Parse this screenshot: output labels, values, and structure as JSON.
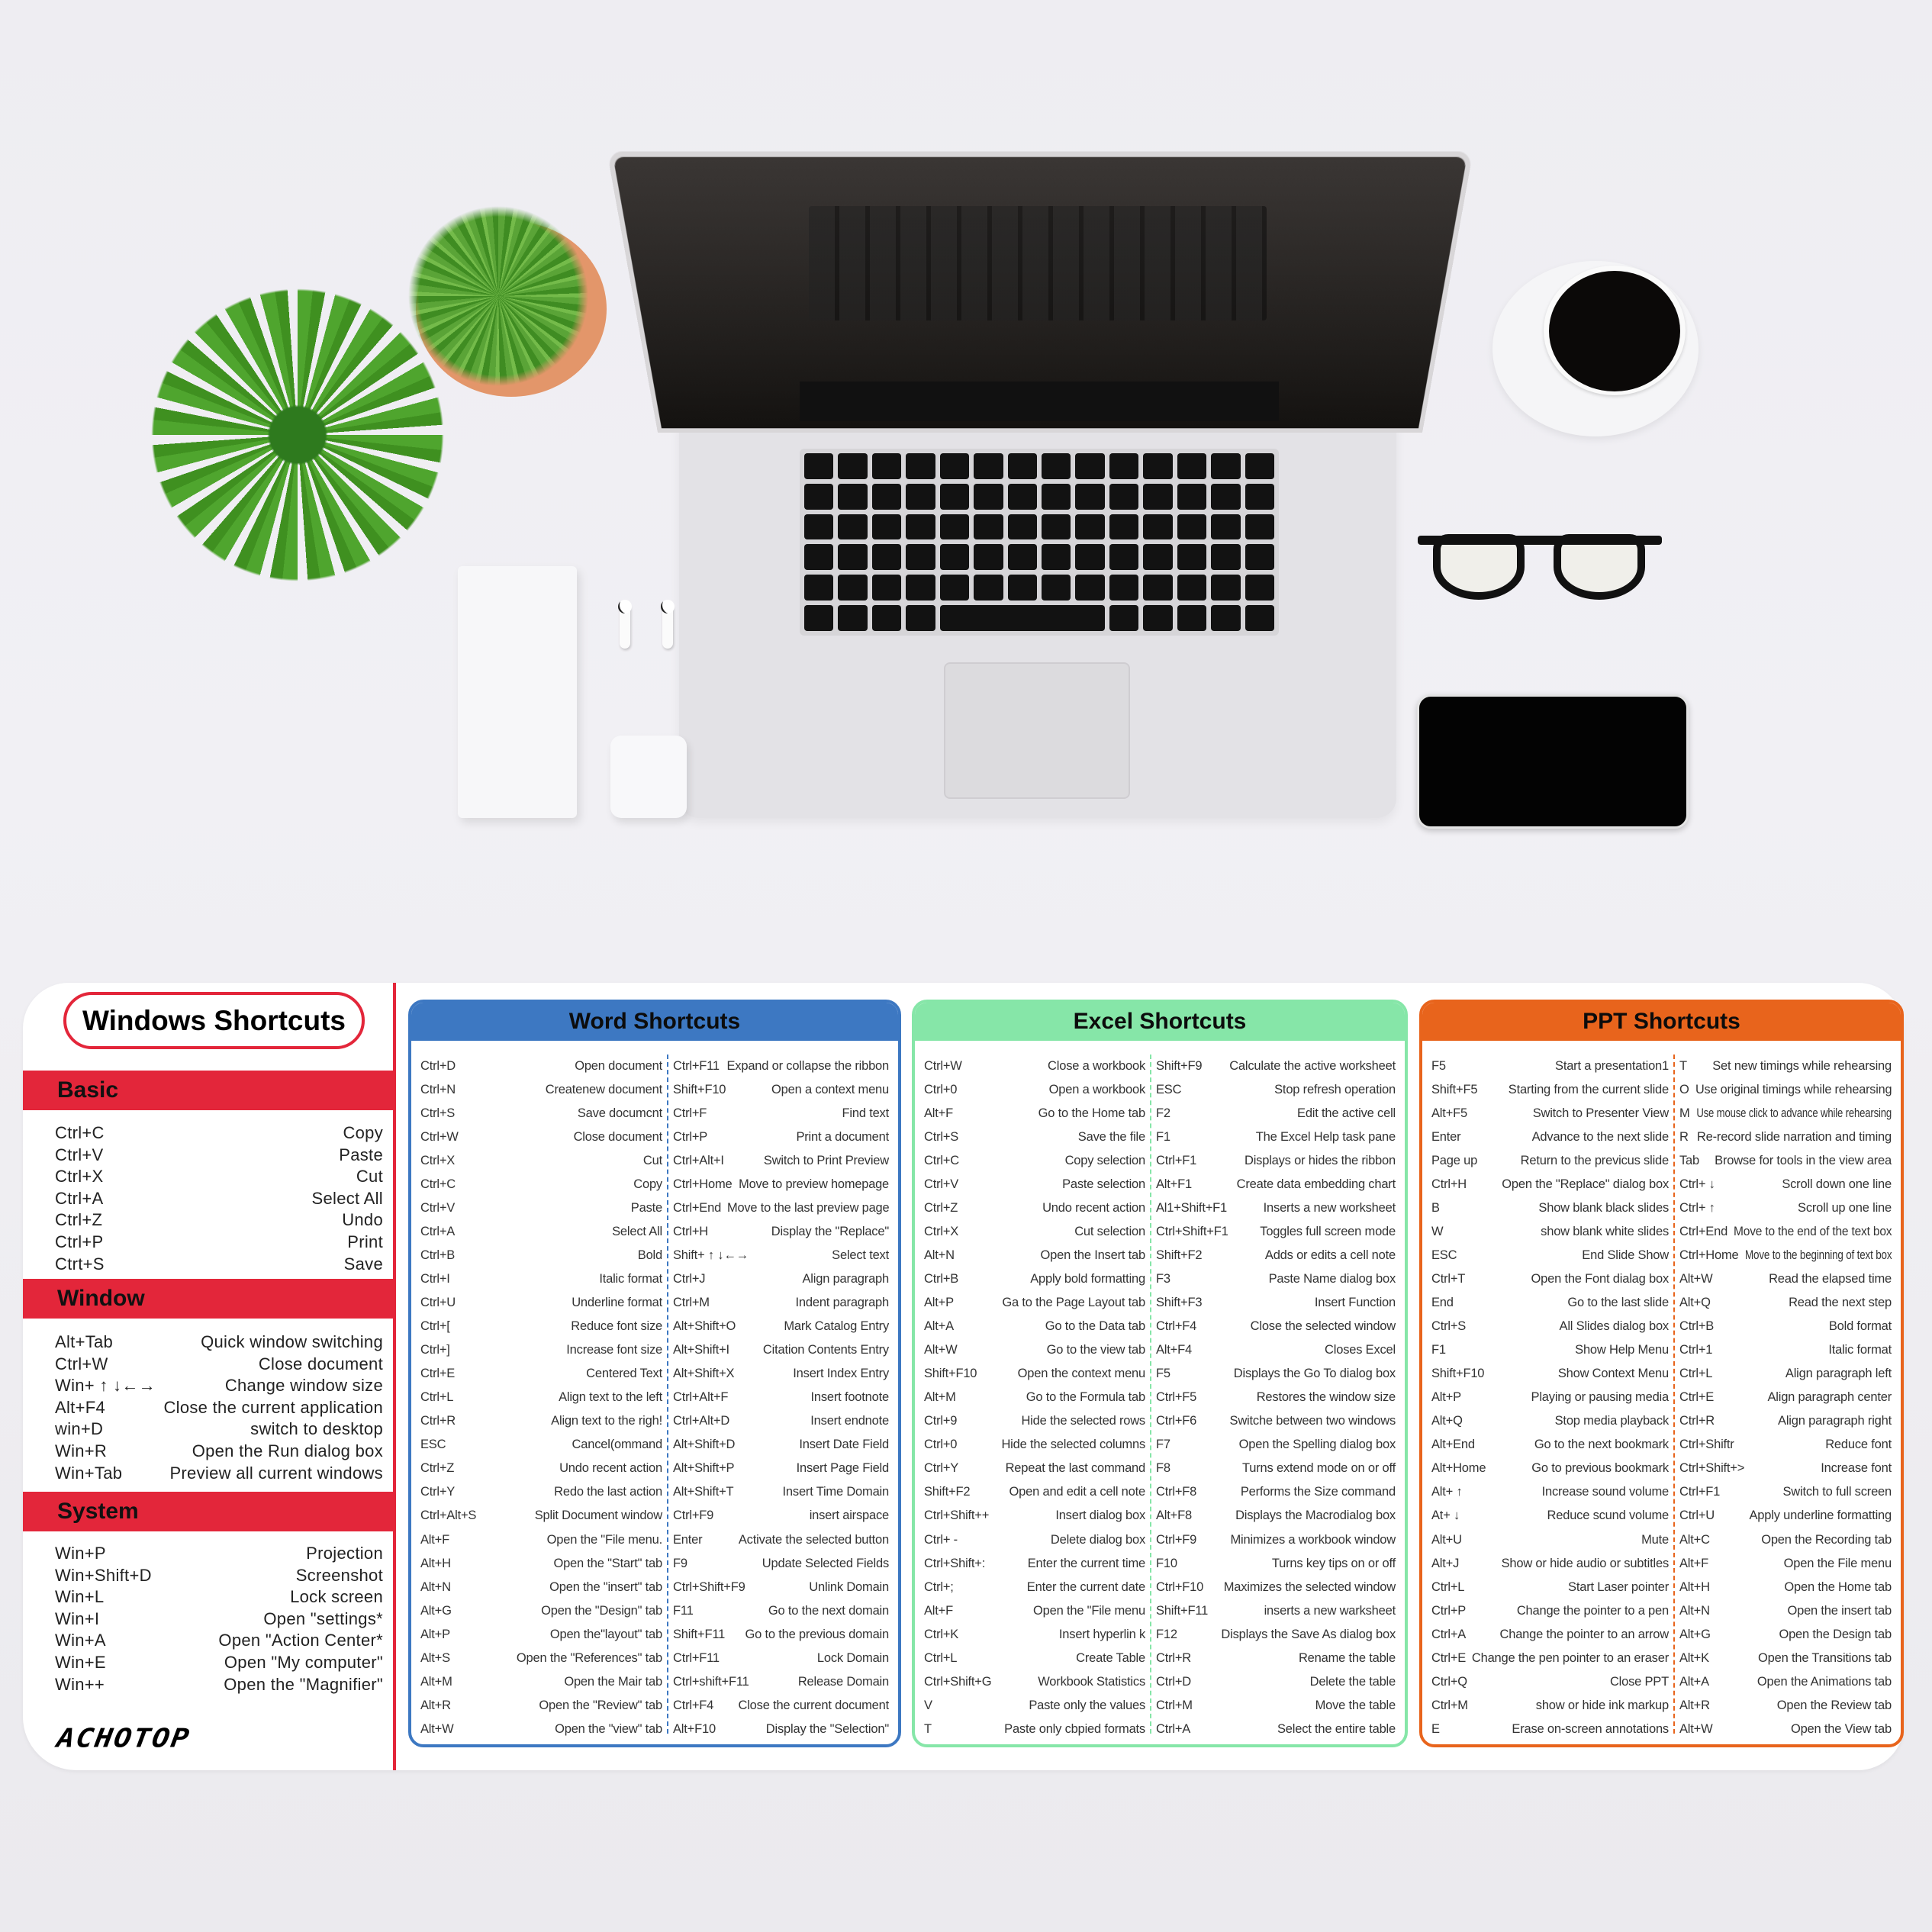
{
  "photo": {
    "objects": [
      "laptop",
      "potted-palm",
      "potted-succulent",
      "notepad",
      "airpods",
      "airpods-case",
      "coffee-cup",
      "glasses",
      "smartphone"
    ]
  },
  "windows": {
    "title": "Windows Shortcuts",
    "brand": "ACHOTOP",
    "sections": [
      {
        "title": "Basic",
        "rows": [
          {
            "key": "Ctrl+C",
            "desc": "Copy"
          },
          {
            "key": "Ctrl+V",
            "desc": "Paste"
          },
          {
            "key": "Ctrl+X",
            "desc": "Cut"
          },
          {
            "key": "Ctrl+A",
            "desc": "Select All"
          },
          {
            "key": "Ctrl+Z",
            "desc": "Undo"
          },
          {
            "key": "Ctrl+P",
            "desc": "Print"
          },
          {
            "key": "Ctrt+S",
            "desc": "Save"
          }
        ]
      },
      {
        "title": "Window",
        "rows": [
          {
            "key": "Alt+Tab",
            "desc": "Quick window switching"
          },
          {
            "key": "Ctrl+W",
            "desc": "Close document"
          },
          {
            "key": "Win+ ↑ ↓←→",
            "desc": "Change window size"
          },
          {
            "key": "Alt+F4",
            "desc": "Close the current application"
          },
          {
            "key": "win+D",
            "desc": "switch to desktop"
          },
          {
            "key": "Win+R",
            "desc": "Open the Run dialog box"
          },
          {
            "key": "Win+Tab",
            "desc": "Preview all current windows"
          }
        ]
      },
      {
        "title": "System",
        "rows": [
          {
            "key": "Win+P",
            "desc": "Projection"
          },
          {
            "key": "Win+Shift+D",
            "desc": "Screenshot"
          },
          {
            "key": "Win+L",
            "desc": "Lock screen"
          },
          {
            "key": "Win+I",
            "desc": "Open \"settings*"
          },
          {
            "key": "Win+A",
            "desc": "Open \"Action Center*"
          },
          {
            "key": "Win+E",
            "desc": "Open \"My computer\""
          },
          {
            "key": "Win++",
            "desc": "Open the \"Magnifier\""
          }
        ]
      }
    ]
  },
  "panels": [
    {
      "id": "word",
      "title": "Word Shortcuts",
      "color": "#3d78c2",
      "left": [
        {
          "key": "Ctrl+D",
          "desc": "Open document"
        },
        {
          "key": "Ctrl+N",
          "desc": "Createnew document"
        },
        {
          "key": "Ctrl+S",
          "desc": "Save documcnt"
        },
        {
          "key": "Ctrl+W",
          "desc": "Close document"
        },
        {
          "key": "Ctrl+X",
          "desc": "Cut"
        },
        {
          "key": "Ctrl+C",
          "desc": "Copy"
        },
        {
          "key": "Ctrl+V",
          "desc": "Paste"
        },
        {
          "key": "Ctrl+A",
          "desc": "Select All"
        },
        {
          "key": "Ctrl+B",
          "desc": "Bold"
        },
        {
          "key": "Ctrl+I",
          "desc": "Italic format"
        },
        {
          "key": "Ctrl+U",
          "desc": "Underline format"
        },
        {
          "key": "Ctrl+[",
          "desc": "Reduce font size"
        },
        {
          "key": "Ctrl+]",
          "desc": "Increase font size"
        },
        {
          "key": "Ctrl+E",
          "desc": "Centered Text"
        },
        {
          "key": "Ctrl+L",
          "desc": "Align text to the left"
        },
        {
          "key": "Ctrl+R",
          "desc": "Align text to the righ!"
        },
        {
          "key": "ESC",
          "desc": "Cancel(ommand"
        },
        {
          "key": "Ctrl+Z",
          "desc": "Undo recent action"
        },
        {
          "key": "Ctrl+Y",
          "desc": "Redo the last action"
        },
        {
          "key": "Ctrl+Alt+S",
          "desc": "Split Document window"
        },
        {
          "key": "Alt+F",
          "desc": "Open the \"File menu."
        },
        {
          "key": "Alt+H",
          "desc": "Open the \"Start\" tab"
        },
        {
          "key": "Alt+N",
          "desc": "Open the \"insert\" tab"
        },
        {
          "key": "Alt+G",
          "desc": "Open the \"Design\" tab"
        },
        {
          "key": "Alt+P",
          "desc": "Open the\"layout\" tab"
        },
        {
          "key": "Alt+S",
          "desc": "Open the \"References\" tab"
        },
        {
          "key": "Alt+M",
          "desc": "Open the Mair tab"
        },
        {
          "key": "Alt+R",
          "desc": "Open the \"Review\" tab"
        },
        {
          "key": "Alt+W",
          "desc": "Open the \"view\" tab"
        }
      ],
      "right": [
        {
          "key": "Ctrl+F11",
          "desc": "Expand or collapse the ribbon"
        },
        {
          "key": "Shift+F10",
          "desc": "Open a context menu"
        },
        {
          "key": "Ctrl+F",
          "desc": "Find text"
        },
        {
          "key": "Ctrl+P",
          "desc": "Print a document"
        },
        {
          "key": "Ctrl+Alt+I",
          "desc": "Switch to Print Preview"
        },
        {
          "key": "Ctrl+Home",
          "desc": "Move to preview homepage"
        },
        {
          "key": "Ctrl+End",
          "desc": "Move to the last preview page"
        },
        {
          "key": "Ctrl+H",
          "desc": "Display the \"Replace\""
        },
        {
          "key": "Shift+ ↑ ↓←→",
          "desc": "Select text"
        },
        {
          "key": "Ctrl+J",
          "desc": "Align paragraph"
        },
        {
          "key": "Ctrl+M",
          "desc": "Indent paragraph"
        },
        {
          "key": "Alt+Shift+O",
          "desc": "Mark Catalog Entry"
        },
        {
          "key": "Alt+Shift+I",
          "desc": "Citation Contents Entry"
        },
        {
          "key": "Alt+Shift+X",
          "desc": "Insert Index Entry"
        },
        {
          "key": "Ctrl+Alt+F",
          "desc": "Insert footnote"
        },
        {
          "key": "Ctrl+Alt+D",
          "desc": "Insert endnote"
        },
        {
          "key": "Alt+Shift+D",
          "desc": "Insert Date Field"
        },
        {
          "key": "Alt+Shift+P",
          "desc": "Insert Page Field"
        },
        {
          "key": "Alt+Shift+T",
          "desc": "Insert Time Domain"
        },
        {
          "key": "Ctrl+F9",
          "desc": "insert airspace"
        },
        {
          "key": "Enter",
          "desc": "Activate the selected button"
        },
        {
          "key": "F9",
          "desc": "Update Selected Fields"
        },
        {
          "key": "Ctrl+Shift+F9",
          "desc": "Unlink Domain"
        },
        {
          "key": "F11",
          "desc": "Go to the next domain"
        },
        {
          "key": "Shift+F11",
          "desc": "Go to the previous domain"
        },
        {
          "key": "Ctrl+F11",
          "desc": "Lock Domain"
        },
        {
          "key": "Ctrl+shift+F11",
          "desc": "Release Domain"
        },
        {
          "key": "Ctrl+F4",
          "desc": "Close the current document"
        },
        {
          "key": "Alt+F10",
          "desc": "Display the \"Selection\""
        }
      ]
    },
    {
      "id": "excel",
      "title": "Excel Shortcuts",
      "color": "#86e6a8",
      "left": [
        {
          "key": "Ctrl+W",
          "desc": "Close a workbook"
        },
        {
          "key": "Ctrl+0",
          "desc": "Open a workbook"
        },
        {
          "key": "Alt+F",
          "desc": "Go to the Home tab"
        },
        {
          "key": "Ctrl+S",
          "desc": "Save the file"
        },
        {
          "key": "Ctrl+C",
          "desc": "Copy selection"
        },
        {
          "key": "Ctrl+V",
          "desc": "Paste selection"
        },
        {
          "key": "Ctrl+Z",
          "desc": "Undo recent action"
        },
        {
          "key": "Ctrl+X",
          "desc": "Cut selection"
        },
        {
          "key": "Alt+N",
          "desc": "Open the Insert tab"
        },
        {
          "key": "Ctrl+B",
          "desc": "Apply bold formatting"
        },
        {
          "key": "Alt+P",
          "desc": "Ga to the Page Layout tab"
        },
        {
          "key": "Alt+A",
          "desc": "Go to the Data tab"
        },
        {
          "key": "Alt+W",
          "desc": "Go to the view tab"
        },
        {
          "key": "Shift+F10",
          "desc": "Open the context menu"
        },
        {
          "key": "Alt+M",
          "desc": "Go to the Formula tab"
        },
        {
          "key": "Ctrl+9",
          "desc": "Hide the selected rows"
        },
        {
          "key": "Ctrl+0",
          "desc": "Hide the selected columns"
        },
        {
          "key": "Ctrl+Y",
          "desc": "Repeat the last command"
        },
        {
          "key": "Shift+F2",
          "desc": "Open and edit a cell note"
        },
        {
          "key": "Ctrl+Shift++",
          "desc": "Insert dialog box"
        },
        {
          "key": "Ctrl+ -",
          "desc": "Delete dialog box"
        },
        {
          "key": "Ctrl+Shift+:",
          "desc": "Enter the current time"
        },
        {
          "key": "Ctrl+;",
          "desc": "Enter the current date"
        },
        {
          "key": "Alt+F",
          "desc": "Open the \"File menu"
        },
        {
          "key": "Ctrl+K",
          "desc": "Insert hyperlin k"
        },
        {
          "key": "Ctrl+L",
          "desc": "Create Table"
        },
        {
          "key": "Ctrl+Shift+G",
          "desc": "Workbook Statistics"
        },
        {
          "key": "V",
          "desc": "Paste only the values"
        },
        {
          "key": "T",
          "desc": "Paste only cbpied formats"
        }
      ],
      "right": [
        {
          "key": "Shift+F9",
          "desc": "Calculate the active worksheet"
        },
        {
          "key": "ESC",
          "desc": "Stop refresh operation"
        },
        {
          "key": "F2",
          "desc": "Edit the active cell"
        },
        {
          "key": "F1",
          "desc": "The Excel Help task pane"
        },
        {
          "key": "Ctrl+F1",
          "desc": "Displays or hides the ribbon"
        },
        {
          "key": "Alt+F1",
          "desc": "Create data embedding chart"
        },
        {
          "key": "Al1+Shift+F1",
          "desc": "Inserts a new worksheet"
        },
        {
          "key": "Ctrl+Shift+F1",
          "desc": "Toggles full screen mode"
        },
        {
          "key": "Shift+F2",
          "desc": "Adds or edits a cell note"
        },
        {
          "key": "F3",
          "desc": "Paste Name dialog box"
        },
        {
          "key": "Shift+F3",
          "desc": "Insert Function"
        },
        {
          "key": "Ctrl+F4",
          "desc": "Close the selected window"
        },
        {
          "key": "Alt+F4",
          "desc": "Closes Excel"
        },
        {
          "key": "F5",
          "desc": "Displays the Go To dialog box"
        },
        {
          "key": "Ctrl+F5",
          "desc": "Restores the window size"
        },
        {
          "key": "Ctrl+F6",
          "desc": "Switche between two windows"
        },
        {
          "key": "F7",
          "desc": "Open the Spelling dialog box"
        },
        {
          "key": "F8",
          "desc": "Turns extend mode on or off"
        },
        {
          "key": "Ctrl+F8",
          "desc": "Performs the Size command"
        },
        {
          "key": "Alt+F8",
          "desc": "Displays the Macrodialog box"
        },
        {
          "key": "Ctrl+F9",
          "desc": "Minimizes a workbook window"
        },
        {
          "key": "F10",
          "desc": "Turns key tips on or off"
        },
        {
          "key": "Ctrl+F10",
          "desc": "Maximizes the selected window"
        },
        {
          "key": "Shift+F11",
          "desc": "inserts a new warksheet"
        },
        {
          "key": "F12",
          "desc": "Displays the Save As dialog box"
        },
        {
          "key": "Ctrl+R",
          "desc": "Rename the table"
        },
        {
          "key": "Ctrl+D",
          "desc": "Delete the table"
        },
        {
          "key": "Ctrl+M",
          "desc": "Move the table"
        },
        {
          "key": "Ctrl+A",
          "desc": "Select the entire table"
        }
      ]
    },
    {
      "id": "ppt",
      "title": "PPT Shortcuts",
      "color": "#e8641c",
      "left": [
        {
          "key": "F5",
          "desc": "Start a presentation1"
        },
        {
          "key": "Shift+F5",
          "desc": "Starting from the current slide"
        },
        {
          "key": "Alt+F5",
          "desc": "Switch to Presenter View"
        },
        {
          "key": "Enter",
          "desc": "Advance to the next slide"
        },
        {
          "key": "Page up",
          "desc": "Return to the previcus slide"
        },
        {
          "key": "Ctrl+H",
          "desc": "Open the \"Replace\" dialog box"
        },
        {
          "key": "B",
          "desc": "Show blank black slides"
        },
        {
          "key": "W",
          "desc": "show blank white slides"
        },
        {
          "key": "ESC",
          "desc": "End Slide Show"
        },
        {
          "key": "Ctrl+T",
          "desc": "Open the Font dialag box"
        },
        {
          "key": "End",
          "desc": "Go to the last slide"
        },
        {
          "key": "Ctrl+S",
          "desc": "All Slides dialog box"
        },
        {
          "key": "F1",
          "desc": "Show Help Menu"
        },
        {
          "key": "Shift+F10",
          "desc": "Show Context Menu"
        },
        {
          "key": "Alt+P",
          "desc": "Playing or pausing media"
        },
        {
          "key": "Alt+Q",
          "desc": "Stop media playback"
        },
        {
          "key": "Alt+End",
          "desc": "Go to the next bookmark"
        },
        {
          "key": "Alt+Home",
          "desc": "Go to previous bookmark"
        },
        {
          "key": "Alt+ ↑",
          "desc": "Increase sound volume"
        },
        {
          "key": "At+ ↓",
          "desc": "Reduce scund volume"
        },
        {
          "key": "Alt+U",
          "desc": "Mute"
        },
        {
          "key": "Alt+J",
          "desc": "Show or hide audio or subtitles"
        },
        {
          "key": "Ctrl+L",
          "desc": "Start Laser pointer"
        },
        {
          "key": "Ctrl+P",
          "desc": "Change the pointer to a pen"
        },
        {
          "key": "Ctrl+A",
          "desc": "Change the pointer to an arrow"
        },
        {
          "key": "Ctrl+E",
          "desc": "Change the pen pointer to an eraser"
        },
        {
          "key": "Ctrl+Q",
          "desc": "Close PPT"
        },
        {
          "key": "Ctrl+M",
          "desc": "show or hide ink markup"
        },
        {
          "key": "E",
          "desc": "Erase on-screen annotations"
        }
      ],
      "right": [
        {
          "key": "T",
          "desc": "Set new timings while rehearsing"
        },
        {
          "key": "O",
          "desc": "Use original timings while rehearsing"
        },
        {
          "key": "M",
          "desc": "Use mouse click to advance while rehearsing"
        },
        {
          "key": "R",
          "desc": "Re-record slide narration and timing"
        },
        {
          "key": "Tab",
          "desc": "Browse for tools in the view area"
        },
        {
          "key": "Ctrl+ ↓",
          "desc": "Scroll down one line"
        },
        {
          "key": "Ctrl+ ↑",
          "desc": "Scroll up one line"
        },
        {
          "key": "Ctrl+End",
          "desc": "Move to the end of the text box"
        },
        {
          "key": "Ctrl+Home",
          "desc": "Move to the beginning of text box"
        },
        {
          "key": "Alt+W",
          "desc": "Read the elapsed time"
        },
        {
          "key": "Alt+Q",
          "desc": "Read the next step"
        },
        {
          "key": "Ctrl+B",
          "desc": "Bold format"
        },
        {
          "key": "Ctrl+1",
          "desc": "Italic format"
        },
        {
          "key": "Ctrl+L",
          "desc": "Align paragraph left"
        },
        {
          "key": "Ctrl+E",
          "desc": "Align paragraph center"
        },
        {
          "key": "Ctrl+R",
          "desc": "Align paragraph right"
        },
        {
          "key": "Ctrl+Shiftr",
          "desc": "Reduce font"
        },
        {
          "key": "Ctrl+Shift+>",
          "desc": "Increase font"
        },
        {
          "key": "Ctrl+F1",
          "desc": "Switch to full screen"
        },
        {
          "key": "Ctrl+U",
          "desc": "Apply underline formatting"
        },
        {
          "key": "Alt+C",
          "desc": "Open the Recording tab"
        },
        {
          "key": "Alt+F",
          "desc": "Open the File menu"
        },
        {
          "key": "Alt+H",
          "desc": "Open the Home tab"
        },
        {
          "key": "Alt+N",
          "desc": "Open the insert tab"
        },
        {
          "key": "Alt+G",
          "desc": "Open the Design tab"
        },
        {
          "key": "Alt+K",
          "desc": "Open the Transitions tab"
        },
        {
          "key": "Alt+A",
          "desc": "Open the Animations tab"
        },
        {
          "key": "Alt+R",
          "desc": "Open the Review tab"
        },
        {
          "key": "Alt+W",
          "desc": "Open the View tab"
        }
      ]
    }
  ]
}
